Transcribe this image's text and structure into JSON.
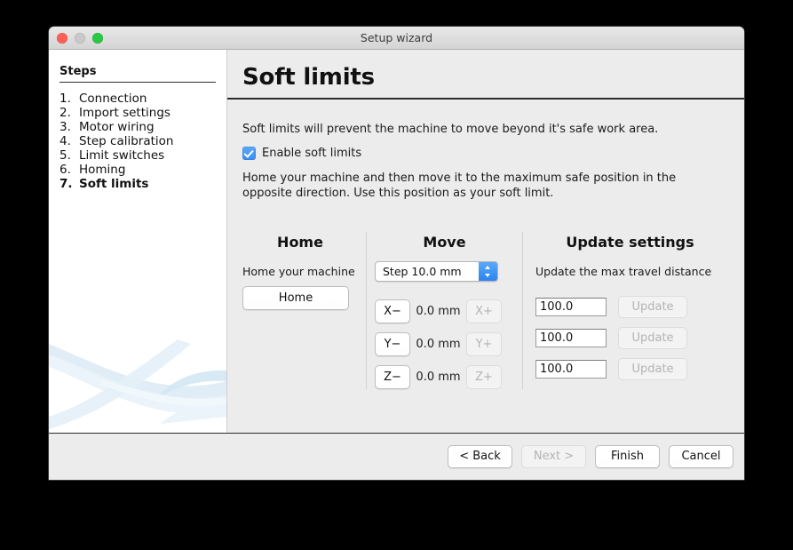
{
  "window": {
    "title": "Setup wizard",
    "traffic_lights": [
      "close-button",
      "minimize-button",
      "zoom-button"
    ]
  },
  "sidebar": {
    "heading": "Steps",
    "items": [
      {
        "number": "1.",
        "label": "Connection",
        "current": false
      },
      {
        "number": "2.",
        "label": "Import settings",
        "current": false
      },
      {
        "number": "3.",
        "label": "Motor wiring",
        "current": false
      },
      {
        "number": "4.",
        "label": "Step calibration",
        "current": false
      },
      {
        "number": "5.",
        "label": "Limit switches",
        "current": false
      },
      {
        "number": "6.",
        "label": "Homing",
        "current": false
      },
      {
        "number": "7.",
        "label": "Soft limits",
        "current": true
      }
    ]
  },
  "main": {
    "title": "Soft limits",
    "intro": "Soft limits will prevent the machine to move beyond it's safe work area.",
    "enable_checkbox": {
      "label": "Enable soft limits",
      "checked": true
    },
    "instructions": "Home your machine and then move it to the maximum safe position in the opposite direction. Use this position as your soft limit.",
    "columns": {
      "home": {
        "title": "Home",
        "subtitle": "Home your machine",
        "button_label": "Home"
      },
      "move": {
        "title": "Move",
        "step_select_value": "Step 10.0 mm",
        "axes": [
          {
            "minus_label": "X−",
            "value": "0.0 mm",
            "plus_label": "X+",
            "plus_disabled": true
          },
          {
            "minus_label": "Y−",
            "value": "0.0 mm",
            "plus_label": "Y+",
            "plus_disabled": true
          },
          {
            "minus_label": "Z−",
            "value": "0.0 mm",
            "plus_label": "Z+",
            "plus_disabled": true
          }
        ]
      },
      "update": {
        "title": "Update settings",
        "subtitle": "Update the max travel distance",
        "rows": [
          {
            "value": "100.0",
            "button_label": "Update",
            "button_disabled": true
          },
          {
            "value": "100.0",
            "button_label": "Update",
            "button_disabled": true
          },
          {
            "value": "100.0",
            "button_label": "Update",
            "button_disabled": true
          }
        ]
      }
    }
  },
  "footer": {
    "buttons": [
      {
        "label": "< Back",
        "disabled": false
      },
      {
        "label": "Next >",
        "disabled": true
      },
      {
        "label": "Finish",
        "disabled": false
      },
      {
        "label": "Cancel",
        "disabled": false
      }
    ]
  },
  "colors": {
    "accent_blue": "#3b8ef3",
    "window_bg": "#ececec",
    "sidebar_bg": "#ffffff",
    "desktop_bg": "#000000",
    "art_blue": "#cfe6f2"
  }
}
